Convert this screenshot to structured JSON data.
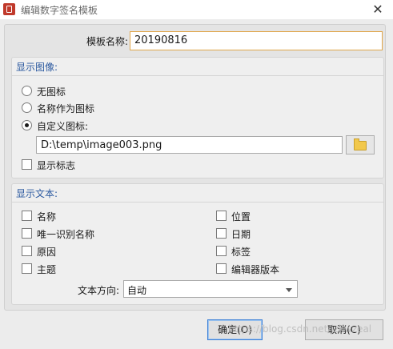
{
  "window": {
    "title": "编辑数字签名模板",
    "close_glyph": "✕"
  },
  "template_name": {
    "label": "模板名称:",
    "value": "20190816"
  },
  "display_image": {
    "group_title": "显示图像:",
    "options": [
      {
        "label": "无图标",
        "checked": false
      },
      {
        "label": "名称作为图标",
        "checked": false
      },
      {
        "label": "自定义图标:",
        "checked": true
      }
    ],
    "custom_path": "D:\\temp\\image003.png",
    "show_logo": {
      "label": "显示标志",
      "checked": false
    }
  },
  "display_text": {
    "group_title": "显示文本:",
    "checkboxes_left": [
      {
        "label": "名称",
        "checked": false
      },
      {
        "label": "唯一识别名称",
        "checked": false
      },
      {
        "label": "原因",
        "checked": false
      },
      {
        "label": "主题",
        "checked": false
      }
    ],
    "checkboxes_right": [
      {
        "label": "位置",
        "checked": false
      },
      {
        "label": "日期",
        "checked": false
      },
      {
        "label": "标签",
        "checked": false
      },
      {
        "label": "编辑器版本",
        "checked": false
      }
    ],
    "direction": {
      "label": "文本方向:",
      "value": "自动"
    }
  },
  "buttons": {
    "ok": "确定(O)",
    "cancel": "取消(C)"
  },
  "watermark": "https://blog.csdn.net/jzkwzeal",
  "colors": {
    "accent_title": "#2c5aa0",
    "focus_border": "#e0a64a",
    "primary_button_border": "#3c7fd6",
    "app_icon": "#c0392b"
  },
  "icons": [
    "app-icon",
    "close-icon",
    "folder-icon",
    "chevron-down-icon"
  ]
}
